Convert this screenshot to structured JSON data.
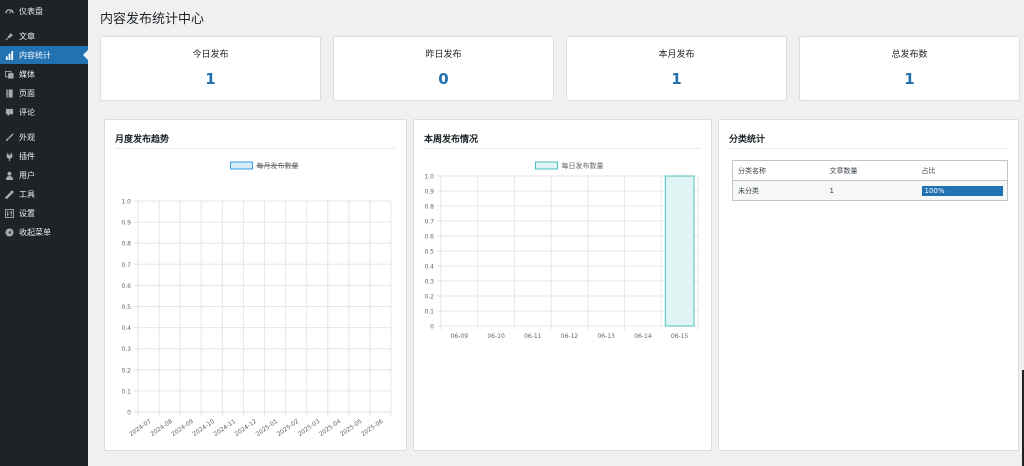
{
  "sidebar": {
    "items": [
      {
        "label": "仪表盘",
        "icon": "dashboard-icon",
        "active": false
      },
      {
        "label": "文章",
        "icon": "pin-icon",
        "active": false
      },
      {
        "label": "内容统计",
        "icon": "bar-chart-icon",
        "active": true
      },
      {
        "label": "媒体",
        "icon": "media-icon",
        "active": false
      },
      {
        "label": "页面",
        "icon": "page-icon",
        "active": false
      },
      {
        "label": "评论",
        "icon": "comment-icon",
        "active": false
      },
      {
        "label": "外观",
        "icon": "brush-icon",
        "active": false
      },
      {
        "label": "插件",
        "icon": "plugin-icon",
        "active": false
      },
      {
        "label": "用户",
        "icon": "user-icon",
        "active": false
      },
      {
        "label": "工具",
        "icon": "wrench-icon",
        "active": false
      },
      {
        "label": "设置",
        "icon": "settings-icon",
        "active": false
      },
      {
        "label": "收起菜单",
        "icon": "collapse-icon",
        "active": false
      }
    ]
  },
  "page": {
    "title": "内容发布统计中心"
  },
  "stats": [
    {
      "label": "今日发布",
      "value": "1"
    },
    {
      "label": "昨日发布",
      "value": "0"
    },
    {
      "label": "本月发布",
      "value": "1"
    },
    {
      "label": "总发布数",
      "value": "1"
    }
  ],
  "colors": {
    "accent": "#2271b1",
    "sidebar": "#1d2327",
    "bar_fill": "#e0f4f4",
    "bar_stroke": "#4bc0c0",
    "legend_fill": "#d6ebf7",
    "legend_stroke": "#36a2eb"
  },
  "panels": {
    "monthly": {
      "title": "月度发布趋势"
    },
    "weekly": {
      "title": "本周发布情况"
    },
    "category": {
      "title": "分类统计",
      "headers": [
        "分类名称",
        "文章数量",
        "占比"
      ],
      "rows": [
        {
          "name": "未分类",
          "count": "1",
          "percent": 100,
          "percent_label": "100%"
        }
      ]
    }
  },
  "chart_data": [
    {
      "type": "line",
      "legend_label": "每月发布数量",
      "legend_hidden": true,
      "categories": [
        "2024-07",
        "2024-08",
        "2024-09",
        "2024-10",
        "2024-11",
        "2024-12",
        "2025-01",
        "2025-02",
        "2025-03",
        "2025-04",
        "2025-05",
        "2025-06"
      ],
      "series": [
        {
          "name": "每月发布数量",
          "values": []
        }
      ],
      "ylim": [
        0,
        1
      ],
      "yticks": [
        "0",
        "0.1",
        "0.2",
        "0.3",
        "0.4",
        "0.5",
        "0.6",
        "0.7",
        "0.8",
        "0.9",
        "1.0"
      ],
      "grid": true,
      "legend_position": "top"
    },
    {
      "type": "bar",
      "legend_label": "每日发布数量",
      "categories": [
        "06-09",
        "06-10",
        "06-11",
        "06-12",
        "06-13",
        "06-14",
        "06-15"
      ],
      "series": [
        {
          "name": "每日发布数量",
          "values": [
            0,
            0,
            0,
            0,
            0,
            0,
            1
          ]
        }
      ],
      "ylim": [
        0,
        1
      ],
      "yticks": [
        "0",
        "0.1",
        "0.2",
        "0.3",
        "0.4",
        "0.5",
        "0.6",
        "0.7",
        "0.8",
        "0.9",
        "1.0"
      ],
      "grid": true,
      "legend_position": "top"
    }
  ]
}
